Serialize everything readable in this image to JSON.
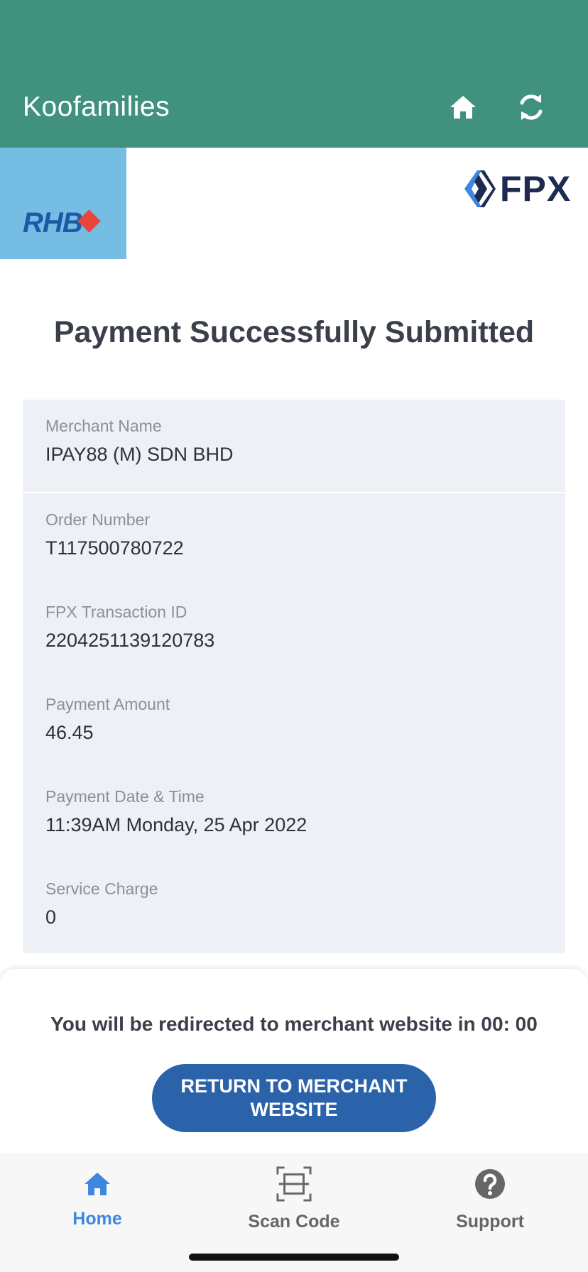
{
  "app_bar": {
    "title": "Koofamilies",
    "background": "#40927f",
    "icons": [
      "home-icon",
      "refresh-icon"
    ]
  },
  "bank": {
    "logo_text": "RHB",
    "logo_background": "#76bde3"
  },
  "payment_gateway": {
    "logo_text": "FPX"
  },
  "status": {
    "title": "Payment Successfully Submitted"
  },
  "details": {
    "merchant_name": {
      "label": "Merchant Name",
      "value": "IPAY88 (M) SDN BHD"
    },
    "order_number": {
      "label": "Order Number",
      "value": "T117500780722"
    },
    "fpx_transaction_id": {
      "label": "FPX Transaction ID",
      "value": "2204251139120783"
    },
    "payment_amount": {
      "label": "Payment Amount",
      "value": "46.45"
    },
    "payment_datetime": {
      "label": "Payment Date & Time",
      "value": "11:39AM Monday, 25 Apr 2022"
    },
    "service_charge": {
      "label": "Service Charge",
      "value": "0"
    }
  },
  "footer": {
    "redirect_text": "You will be redirected to merchant website in 00: 00",
    "return_button": "RETURN TO MERCHANT WEBSITE"
  },
  "tab_bar": {
    "home": {
      "label": "Home",
      "icon": "home-icon",
      "active": true
    },
    "scan": {
      "label": "Scan Code",
      "icon": "scan-code-icon",
      "active": false
    },
    "support": {
      "label": "Support",
      "icon": "help-icon",
      "active": false
    }
  },
  "colors": {
    "accent": "#40927f",
    "primary_button": "#2b63ab",
    "tab_active": "#3f86e0",
    "tab_inactive": "#666666"
  }
}
